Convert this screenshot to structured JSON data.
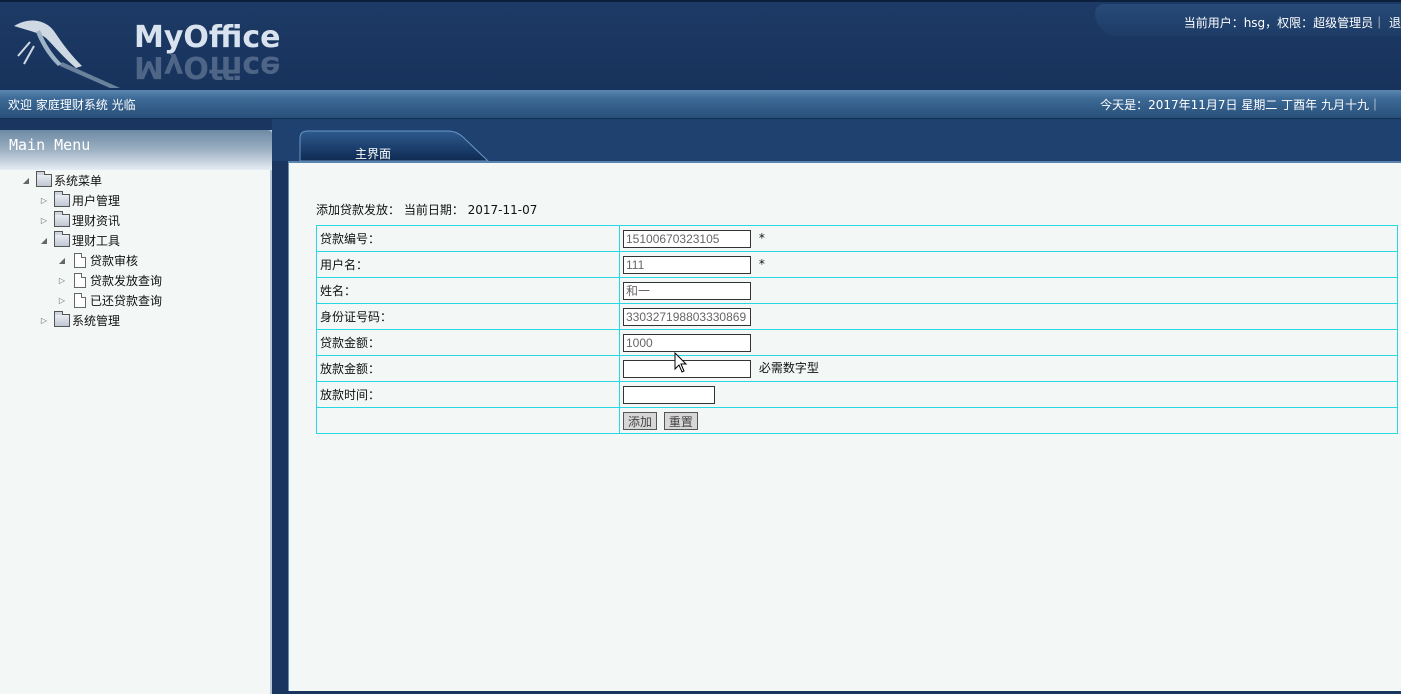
{
  "header": {
    "app_title": "MyOffice",
    "user_info": "当前用户：hsg，权限：超级管理员｜ 退"
  },
  "welcome_bar": {
    "welcome": "欢迎 家庭理财系统 光临",
    "date": "今天是：2017年11月7日 星期二 丁酉年 九月十九｜"
  },
  "menu": {
    "title": "Main Menu",
    "items": [
      {
        "label": "系统菜单",
        "icon": "folder-icon",
        "expanded": true
      },
      {
        "label": "用户管理",
        "icon": "folder-icon",
        "expanded": false
      },
      {
        "label": "理财资讯",
        "icon": "folder-icon",
        "expanded": false
      },
      {
        "label": "理财工具",
        "icon": "folder-icon",
        "expanded": true
      },
      {
        "label": "贷款审核",
        "icon": "document-icon",
        "expanded": true
      },
      {
        "label": "贷款发放查询",
        "icon": "document-icon",
        "expanded": false
      },
      {
        "label": "已还贷款查询",
        "icon": "document-icon",
        "expanded": false
      },
      {
        "label": "系统管理",
        "icon": "folder-icon",
        "expanded": false
      }
    ]
  },
  "tabs": [
    {
      "label": "主界面",
      "active": true
    }
  ],
  "form": {
    "caption": "添加贷款发放：  当前日期：  2017-11-07",
    "rows": [
      {
        "label": "贷款编号：",
        "value": "15100670323105",
        "suffix": "*"
      },
      {
        "label": "用户名：",
        "value": "111",
        "suffix": "*"
      },
      {
        "label": "姓名：",
        "value": "和一",
        "suffix": ""
      },
      {
        "label": "身份证号码：",
        "value": "330327198803330869",
        "suffix": ""
      },
      {
        "label": "贷款金额：",
        "value": "1000",
        "suffix": ""
      },
      {
        "label": "放款金额：",
        "value": "",
        "suffix": "必需数字型"
      },
      {
        "label": "放款时间：",
        "value": "",
        "suffix": ""
      }
    ],
    "add_label": "添加",
    "reset_label": "重置"
  },
  "colors": {
    "header_bg": "#1d3a66",
    "content_bg": "#f3f8f6",
    "table_border": "#28d6e4"
  }
}
